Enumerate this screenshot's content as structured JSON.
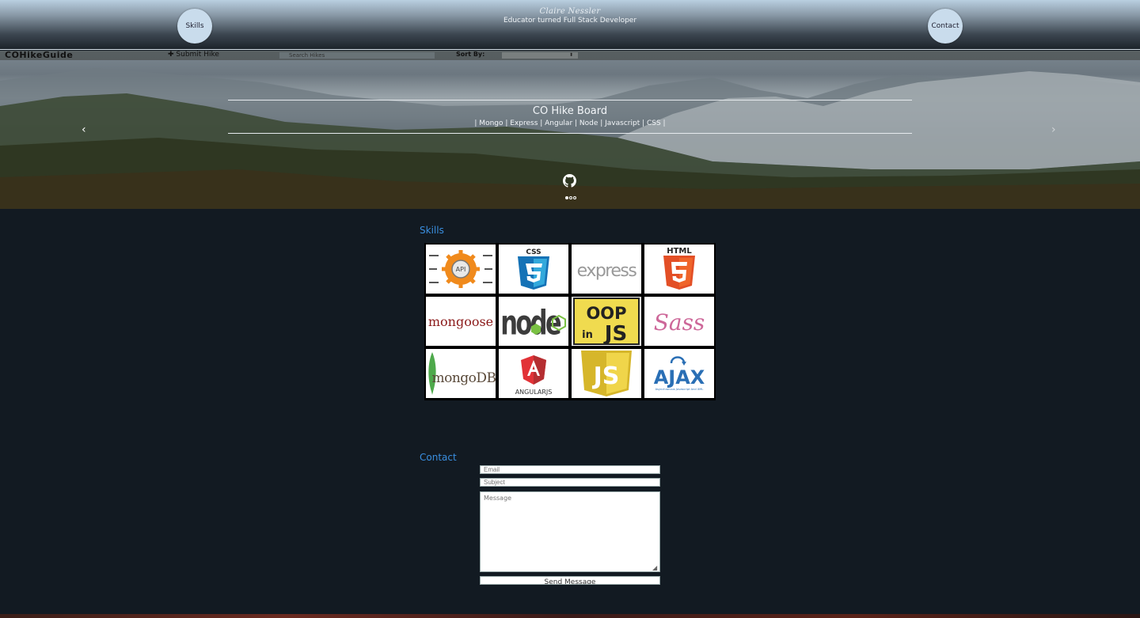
{
  "header": {
    "brand_name": "Claire Nessler",
    "brand_subtitle": "Educator turned Full Stack Developer",
    "nav_left": "Skills",
    "nav_right": "Contact"
  },
  "project_strip": {
    "logo": "COHikeGuide",
    "submit": "✚ Submit Hike",
    "search_placeholder": "Search Hikes",
    "sort_label": "Sort By:",
    "sort_value": "⬍"
  },
  "carousel": {
    "title": "CO Hike Board",
    "stack": "| Mongo | Express | Angular | Node | Javascript | CSS |",
    "prev": "‹",
    "next": "›",
    "slides": 3,
    "active_slide": 1
  },
  "skills": {
    "title": "Skills",
    "tiles": [
      {
        "name": "api",
        "label": "API"
      },
      {
        "name": "css3",
        "label": "CSS"
      },
      {
        "name": "express",
        "label": "express"
      },
      {
        "name": "html5",
        "label": "HTML"
      },
      {
        "name": "mongoose",
        "label": "mongoose"
      },
      {
        "name": "nodejs",
        "label": "node"
      },
      {
        "name": "oop-in-js",
        "label": "OOP in JS"
      },
      {
        "name": "sass",
        "label": "Sass"
      },
      {
        "name": "mongodb",
        "label": "mongoDB"
      },
      {
        "name": "angularjs",
        "label": "ANGULARJS"
      },
      {
        "name": "javascript",
        "label": "JS"
      },
      {
        "name": "ajax",
        "label": "AJAX",
        "caption": "Asynchronous Javascript And XML"
      }
    ]
  },
  "contact": {
    "title": "Contact",
    "email_placeholder": "Email",
    "subject_placeholder": "Subject",
    "message_placeholder": "Message",
    "send_label": "Send Message"
  },
  "colors": {
    "accent": "#3a8fe0",
    "background": "#121a22",
    "nav_circle": "#c9dcec"
  }
}
